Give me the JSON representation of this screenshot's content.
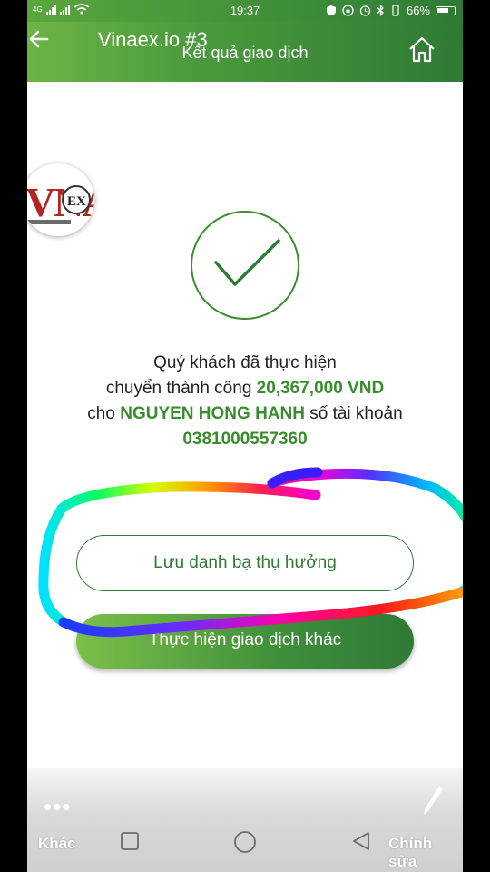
{
  "status_bar": {
    "network_label": "4G",
    "time": "19:37",
    "battery": "66%"
  },
  "header": {
    "title": "Vinaex.io #3",
    "subtitle": "Kết quả giao dịch",
    "back_icon": "arrow-left-icon",
    "home_icon": "home-icon"
  },
  "logo": {
    "text": "VINAEX",
    "colors": {
      "primary": "#b3261e",
      "secondary": "#1a1a1a"
    }
  },
  "result": {
    "line1": "Quý khách đã thực hiện",
    "line2_prefix": "chuyển thành công ",
    "amount": "20,367,000 VND",
    "line3_prefix": "cho ",
    "recipient": "NGUYEN HONG HANH",
    "line3_suffix": " số tài khoản",
    "account": "0381000557360"
  },
  "buttons": {
    "save_beneficiary": "Lưu danh bạ thụ hưởng",
    "new_transaction": "Thực hiện giao dịch khác"
  },
  "bottom_bar": {
    "more_label": "Khác",
    "edit_label": "Chỉnh sửa"
  },
  "colors": {
    "brand_green": "#2f7a35",
    "accent_green": "#3a8c2f",
    "header_light": "#6cb444"
  }
}
